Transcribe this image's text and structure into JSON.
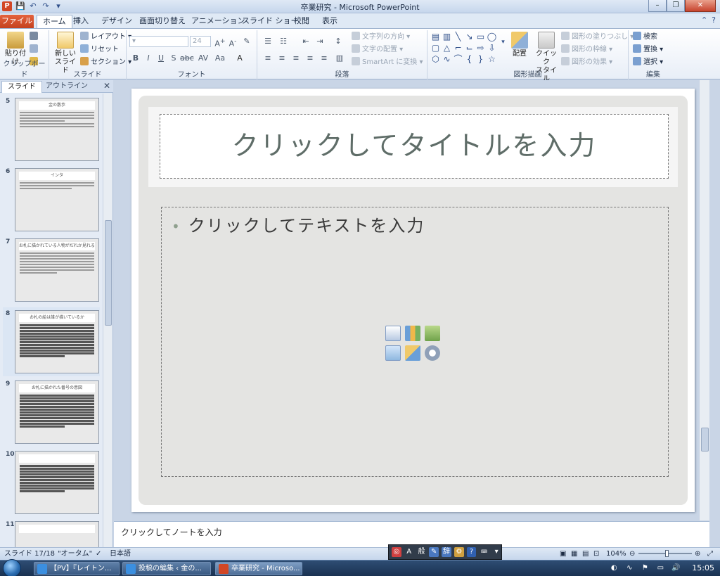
{
  "titlebar": {
    "title": "卒業研究 - Microsoft PowerPoint",
    "app_icon": "P"
  },
  "tabs": [
    {
      "label": "ファイル"
    },
    {
      "label": "ホーム"
    },
    {
      "label": "挿入"
    },
    {
      "label": "デザイン"
    },
    {
      "label": "画面切り替え"
    },
    {
      "label": "アニメーション"
    },
    {
      "label": "スライド ショー"
    },
    {
      "label": "校閲"
    },
    {
      "label": "表示"
    }
  ],
  "ribbon": {
    "clipboard": {
      "paste": "貼り付け",
      "label": "クリップボード"
    },
    "slides": {
      "new_slide_1": "新しい",
      "new_slide_2": "スライド",
      "layout": "レイアウト",
      "reset": "リセット",
      "section": "セクション",
      "label": "スライド"
    },
    "font": {
      "font_size": "24",
      "label": "フォント"
    },
    "paragraph": {
      "text_direction": "文字列の方向",
      "align_text": "文字の配置",
      "smartart": "SmartArt に変換",
      "label": "段落"
    },
    "drawing": {
      "arrange": "配置",
      "quick_styles_1": "クイック",
      "quick_styles_2": "スタイル",
      "shape_fill": "図形の塗りつぶし",
      "shape_outline": "図形の枠線",
      "shape_effects": "図形の効果",
      "label": "図形描画"
    },
    "editing": {
      "find": "検索",
      "replace": "置換",
      "select": "選択",
      "label": "編集"
    }
  },
  "left_pane": {
    "tab_slides": "スライド",
    "tab_outline": "アウトライン",
    "thumbs": [
      {
        "num": "5",
        "title": "金の散歩"
      },
      {
        "num": "6",
        "title": "インタ"
      },
      {
        "num": "7",
        "title": "お札に描かれている人物がだれか見れるの?"
      },
      {
        "num": "8",
        "title": "お札の絵は誰が描いているか"
      },
      {
        "num": "9",
        "title": "お札に描かれた番号の意図"
      },
      {
        "num": "10",
        "title": ""
      },
      {
        "num": "11",
        "title": ""
      }
    ]
  },
  "slide": {
    "title_placeholder": "クリックしてタイトルを入力",
    "body_placeholder": "クリックしてテキストを入力"
  },
  "notes": {
    "placeholder": "クリックしてノートを入力"
  },
  "statusbar": {
    "slide_pos": "スライド 17/18",
    "theme": "\"オータム\"",
    "language": "日本語",
    "zoom": "104%"
  },
  "taskbar": {
    "buttons": [
      {
        "label": "【PV】『レイトン..."
      },
      {
        "label": "投稿の編集 ‹ 金の..."
      },
      {
        "label": "卒業研究 - Microso..."
      }
    ],
    "clock": "15:05"
  },
  "colors": {
    "file_tab": "#d24726",
    "title_text": "#5f6d68",
    "ribbon_bg": "#e8eef7"
  }
}
